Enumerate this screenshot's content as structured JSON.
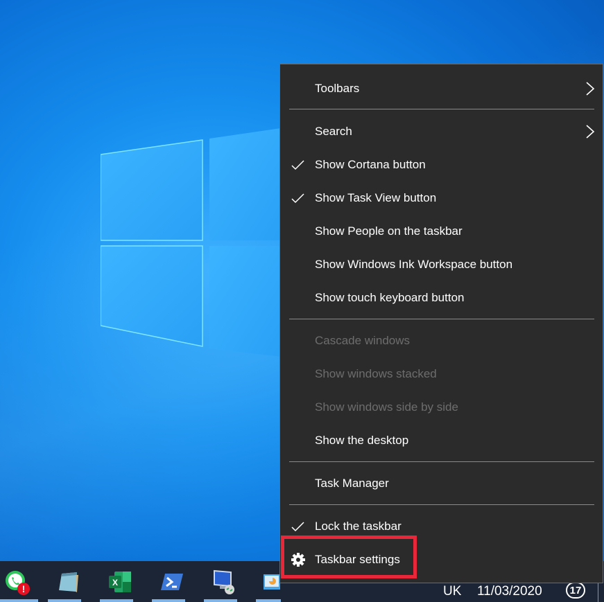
{
  "desktop": {
    "wallpaper": "windows-10-logo-wallpaper",
    "accent_color": "#168fef"
  },
  "context_menu": {
    "groups": [
      [
        {
          "label": "Toolbars",
          "checked": false,
          "submenu": true,
          "enabled": true
        }
      ],
      [
        {
          "label": "Search",
          "checked": false,
          "submenu": true,
          "enabled": true
        },
        {
          "label": "Show Cortana button",
          "checked": true,
          "submenu": false,
          "enabled": true
        },
        {
          "label": "Show Task View button",
          "checked": true,
          "submenu": false,
          "enabled": true
        },
        {
          "label": "Show People on the taskbar",
          "checked": false,
          "submenu": false,
          "enabled": true
        },
        {
          "label": "Show Windows Ink Workspace button",
          "checked": false,
          "submenu": false,
          "enabled": true
        },
        {
          "label": "Show touch keyboard button",
          "checked": false,
          "submenu": false,
          "enabled": true
        }
      ],
      [
        {
          "label": "Cascade windows",
          "checked": false,
          "submenu": false,
          "enabled": false
        },
        {
          "label": "Show windows stacked",
          "checked": false,
          "submenu": false,
          "enabled": false
        },
        {
          "label": "Show windows side by side",
          "checked": false,
          "submenu": false,
          "enabled": false
        },
        {
          "label": "Show the desktop",
          "checked": false,
          "submenu": false,
          "enabled": true
        }
      ],
      [
        {
          "label": "Task Manager",
          "checked": false,
          "submenu": false,
          "enabled": true
        }
      ],
      [
        {
          "label": "Lock the taskbar",
          "checked": true,
          "submenu": false,
          "enabled": true
        },
        {
          "label": "Taskbar settings",
          "icon": "gear-icon",
          "checked": false,
          "submenu": false,
          "enabled": true,
          "highlighted": true
        }
      ]
    ],
    "highlight_color": "#e8283a"
  },
  "taskbar": {
    "apps": [
      {
        "name": "WhatsApp",
        "icon": "whatsapp-icon",
        "badge": "!"
      },
      {
        "name": "Notepad",
        "icon": "notepad-icon"
      },
      {
        "name": "Excel",
        "icon": "excel-icon",
        "letter": "X"
      },
      {
        "name": "PowerShell",
        "icon": "powershell-icon"
      },
      {
        "name": "Remote Desktop",
        "icon": "remote-desktop-icon"
      },
      {
        "name": "Unknown app",
        "icon": "app-icon"
      }
    ],
    "tray": {
      "language": "UK",
      "date": "11/03/2020",
      "notifications_count": "17"
    }
  }
}
